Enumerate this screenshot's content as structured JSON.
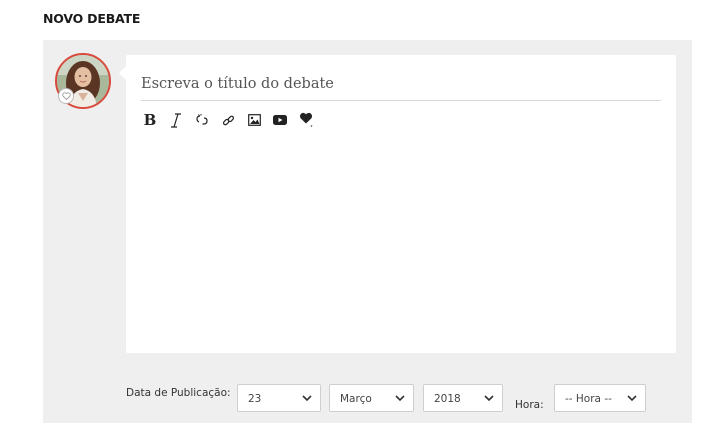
{
  "page": {
    "title": "NOVO DEBATE"
  },
  "editor": {
    "title_placeholder": "Escreva o título do debate",
    "toolbar": [
      {
        "name": "bold",
        "label": "B"
      },
      {
        "name": "italic",
        "label": "I"
      },
      {
        "name": "unlink",
        "icon": "unlink-icon"
      },
      {
        "name": "link",
        "icon": "link-icon"
      },
      {
        "name": "image",
        "icon": "image-icon"
      },
      {
        "name": "video",
        "icon": "youtube-icon"
      },
      {
        "name": "emoji",
        "icon": "heart-icon"
      }
    ]
  },
  "publication": {
    "date_label": "Data de Publicação:",
    "day": "23",
    "month": "Março",
    "year": "2018",
    "time_label": "Hora:",
    "time_value": "-- Hora --"
  },
  "colors": {
    "accent": "#d94a3d",
    "panel": "#efefef"
  }
}
